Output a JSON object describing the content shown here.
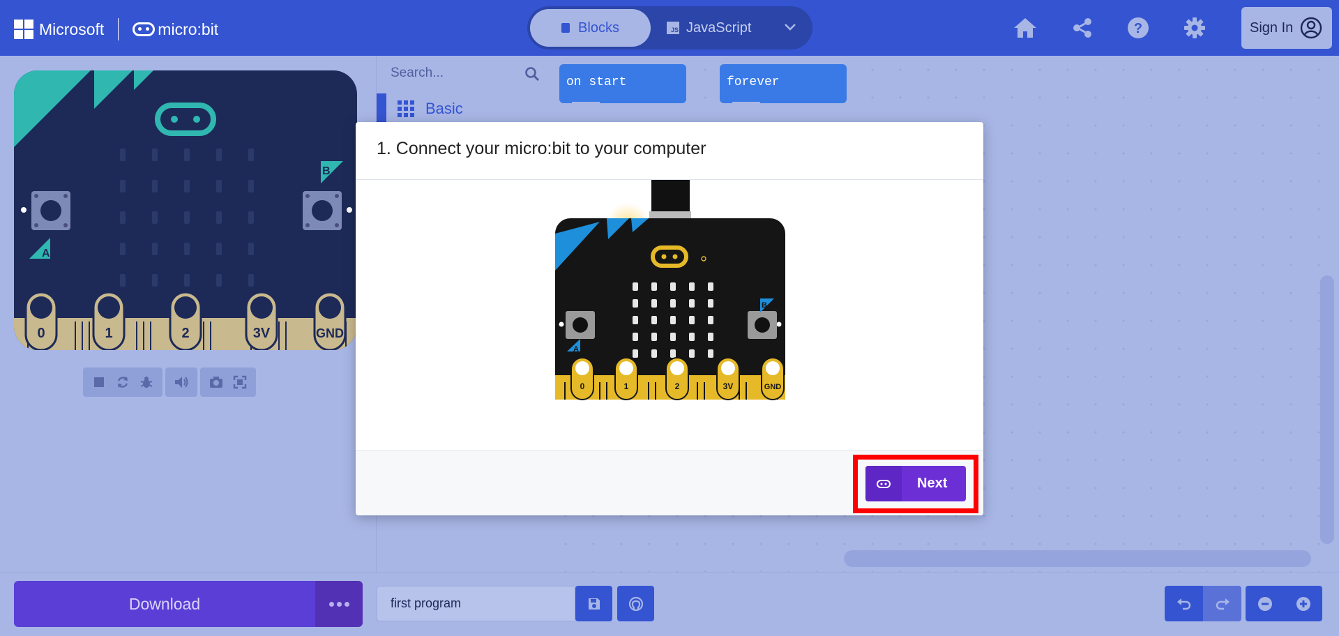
{
  "header": {
    "brand": "Microsoft",
    "product": "micro:bit",
    "editor_toggle": {
      "blocks_label": "Blocks",
      "javascript_label": "JavaScript",
      "js_badge": "JS"
    },
    "signin_label": "Sign In"
  },
  "simulator": {
    "pins": [
      "0",
      "1",
      "2",
      "3V",
      "GND"
    ],
    "button_a": "A",
    "button_b": "B"
  },
  "toolbox": {
    "search_placeholder": "Search...",
    "category_label": "Basic"
  },
  "workspace": {
    "blocks": [
      "on start",
      "forever"
    ]
  },
  "modal": {
    "title": "1. Connect your micro:bit to your computer",
    "illustration_pins": [
      "0",
      "1",
      "2",
      "3V",
      "GND"
    ],
    "illustration_button_a": "A",
    "illustration_button_b": "B",
    "next_label": "Next"
  },
  "footer": {
    "download_label": "Download",
    "project_name": "first program"
  },
  "colors": {
    "header": "#3454d1",
    "background": "#a8b6e6",
    "board": "#1d2a58",
    "accent_teal": "#2fb7b0",
    "download": "#5b3ed6",
    "next_button": "#6c2fd6",
    "highlight": "#ff0000"
  }
}
